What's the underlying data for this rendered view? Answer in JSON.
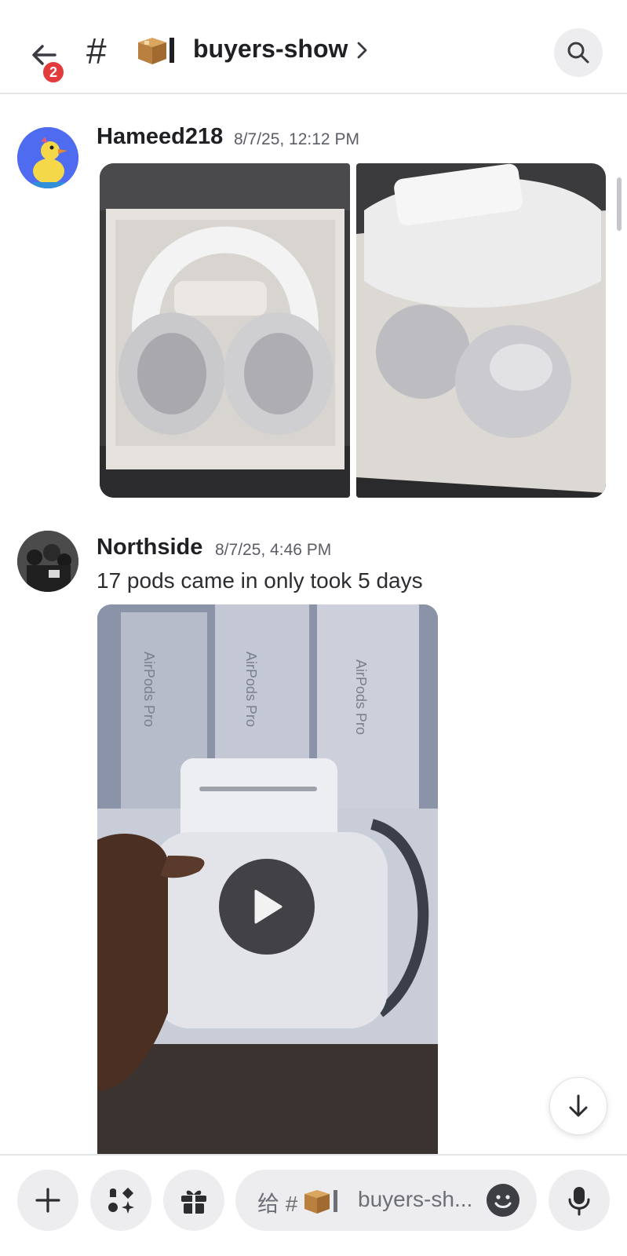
{
  "header": {
    "back_badge": "2",
    "channel_hash": "#",
    "channel_name": "buyers-show",
    "channel_emoji": "package-box-emoji",
    "icons": [
      "back-arrow-icon",
      "chevron-right-icon",
      "search-icon"
    ]
  },
  "messages": [
    {
      "author": "Hameed218",
      "timestamp": "8/7/25, 12:12 PM",
      "text": "",
      "attachments": [
        "headphones-in-box-photo",
        "headphones-case-photo"
      ]
    },
    {
      "author": "Northside",
      "timestamp": "8/7/25, 4:46 PM",
      "text": "17 pods came in only took 5 days",
      "attachments": [
        "airpods-video"
      ]
    }
  ],
  "composer": {
    "placeholder_prefix": "给 #",
    "placeholder_channel": "buyers-sh...",
    "icons": [
      "plus-icon",
      "apps-icon",
      "gift-icon",
      "emoji-icon",
      "microphone-icon"
    ]
  },
  "jump_button_icon": "arrow-down-icon",
  "colors": {
    "badge": "#e23b3b",
    "button_bg": "#ededef",
    "divider": "#e3e4e6",
    "text_primary": "#1f2023",
    "text_muted": "#5c5e66"
  }
}
